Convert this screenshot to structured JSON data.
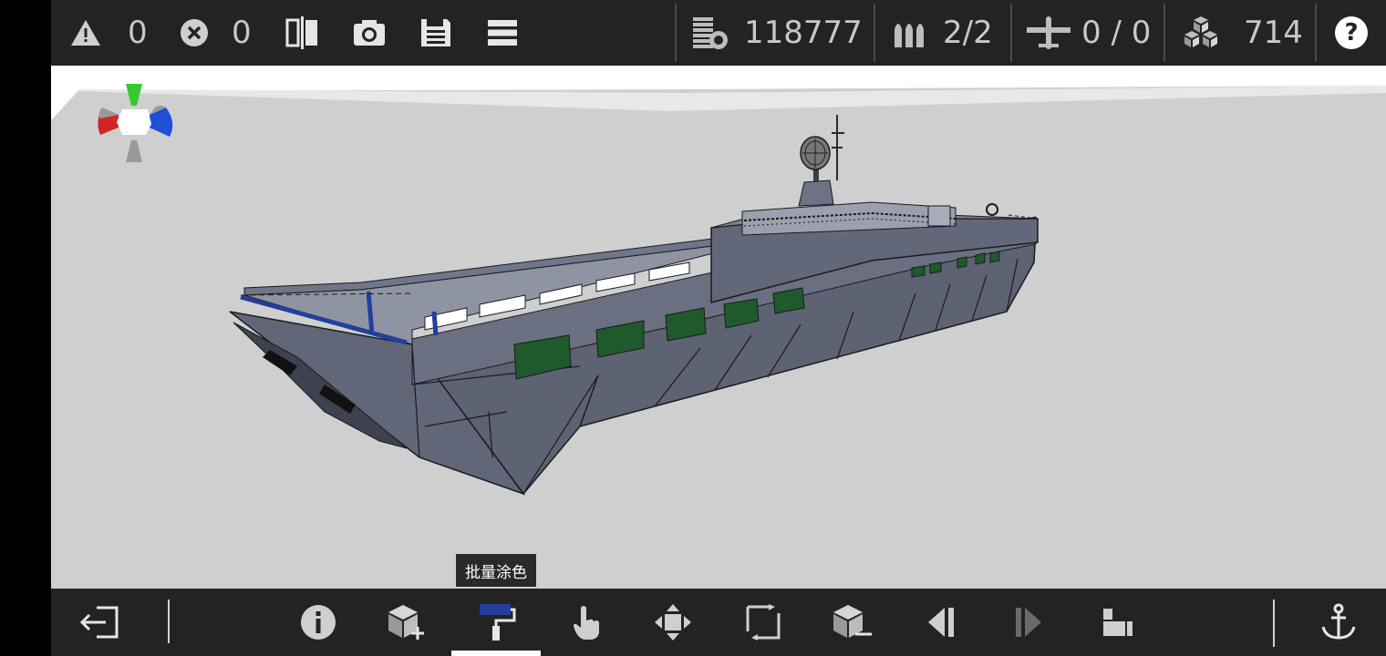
{
  "topbar": {
    "warnings_count": "0",
    "errors_count": "0",
    "cost_value": "118777",
    "ammo_value": "2/2",
    "aircraft_value": "0 / 0",
    "blocks_value": "714",
    "help_label": "?"
  },
  "tooltip": {
    "label": "批量涂色"
  },
  "colors": {
    "hull": "#5c6272",
    "window_green": "#1f5a2c",
    "accent_blue": "#233f9c",
    "viewport_bg": "#cfcfcf",
    "bar_bg": "#232323"
  },
  "bottombar": {
    "tools": [
      "exit-icon",
      "info-icon",
      "add-block-icon",
      "paint-roller-icon",
      "select-hand-icon",
      "move-icon",
      "rotate-icon",
      "remove-block-icon",
      "prev-icon",
      "next-icon",
      "camera-mode-icon",
      "anchor-icon"
    ],
    "active_tool": "paint-roller-icon"
  }
}
